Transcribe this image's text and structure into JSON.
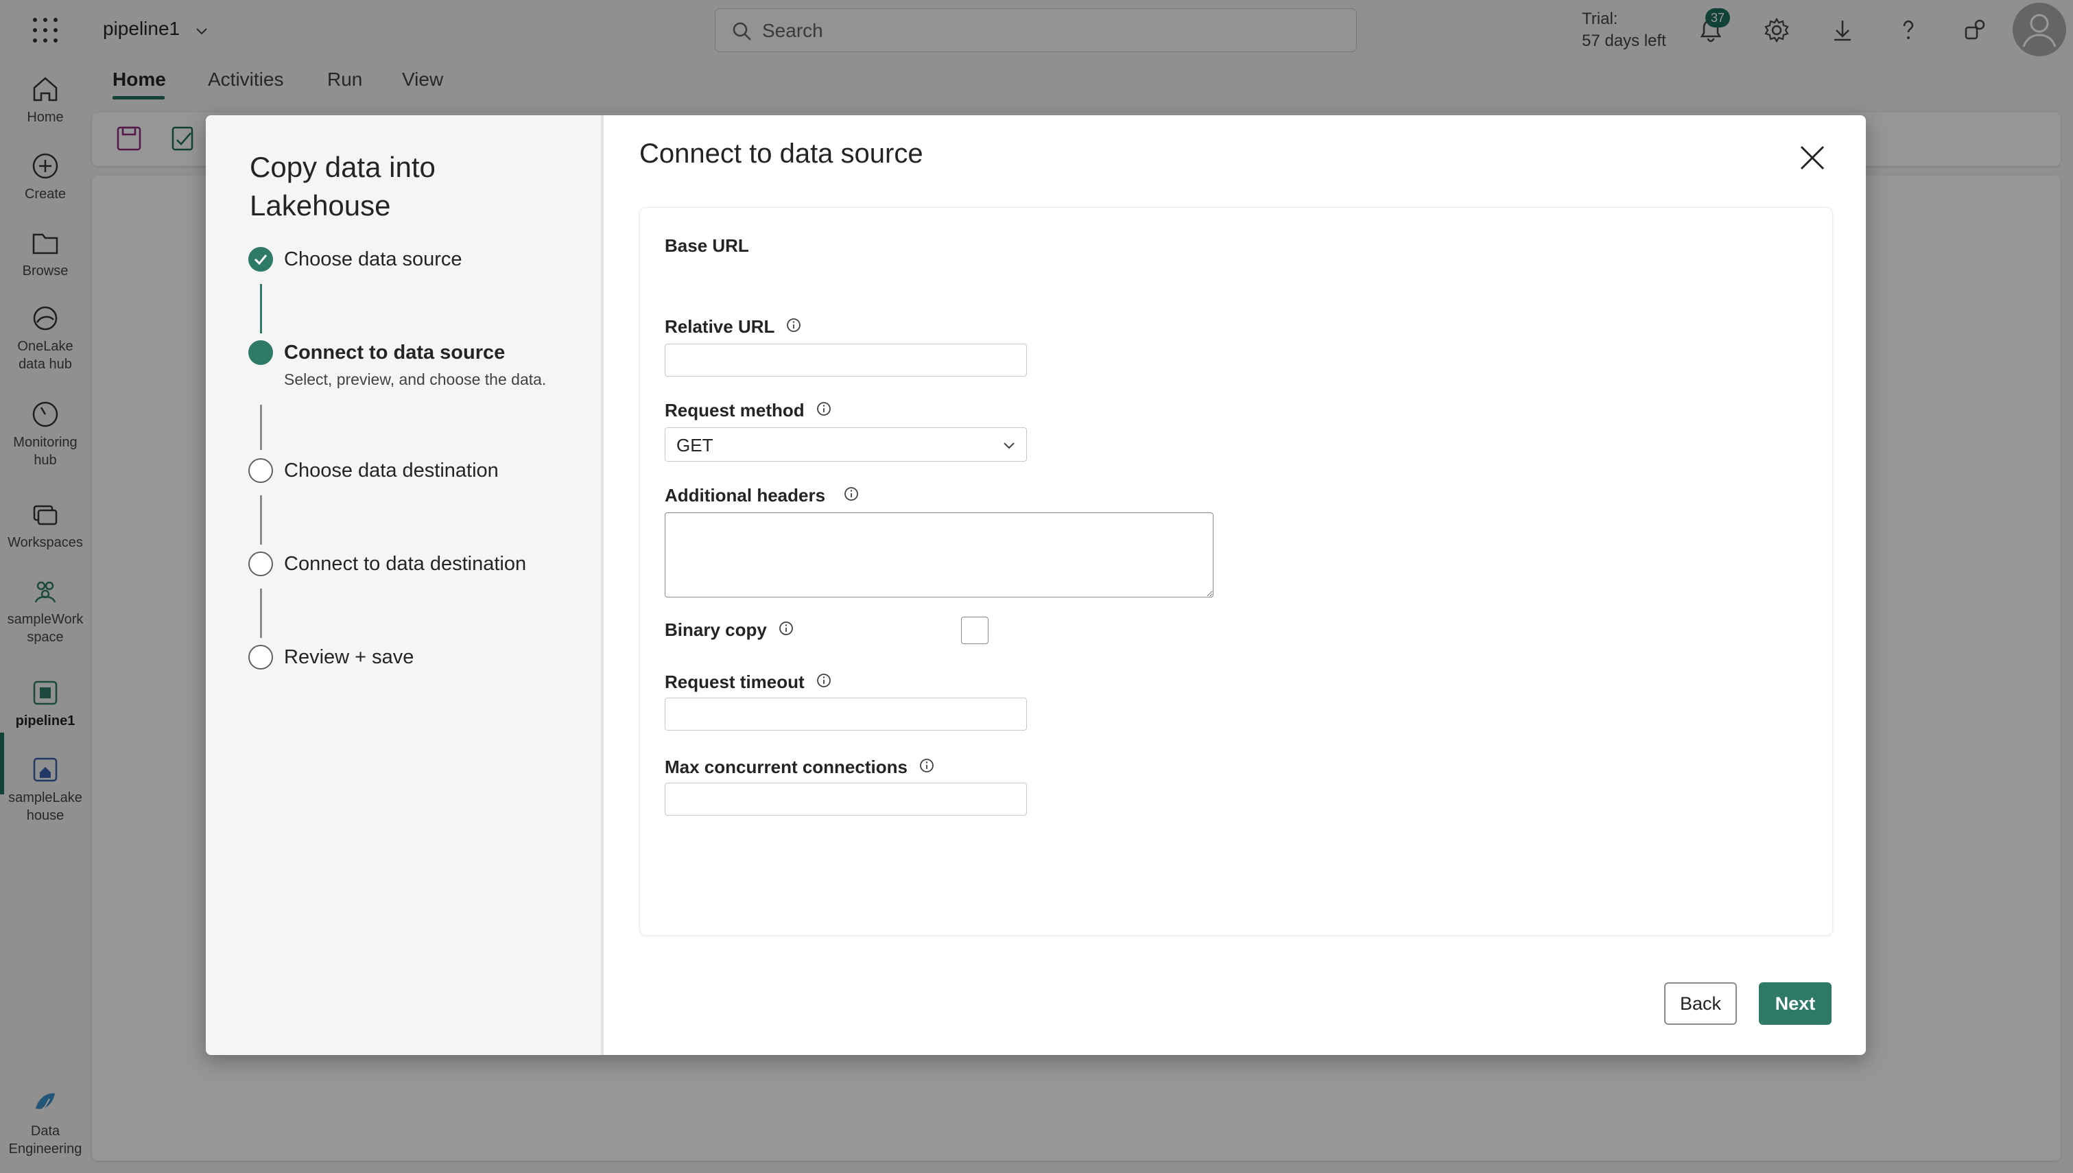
{
  "app": {
    "title": "pipeline1",
    "search_placeholder": "Search",
    "trial_line1": "Trial:",
    "trial_line2": "57 days left",
    "notification_count": "37"
  },
  "rail": [
    {
      "label": "Home",
      "icon": "home-icon"
    },
    {
      "label": "Create",
      "icon": "create-icon"
    },
    {
      "label": "Browse",
      "icon": "browse-icon"
    },
    {
      "label": "OneLake\ndata hub",
      "icon": "onelake-icon"
    },
    {
      "label": "Monitoring\nhub",
      "icon": "monitoring-icon"
    },
    {
      "label": "Workspaces",
      "icon": "workspaces-icon"
    },
    {
      "label": "sampleWork\nspace",
      "icon": "workspace-icon"
    },
    {
      "label": "pipeline1",
      "icon": "pipeline-icon"
    },
    {
      "label": "sampleLake\nhouse",
      "icon": "lakehouse-icon"
    },
    {
      "label": "Data\nEngineering",
      "icon": "data-engineering-icon"
    }
  ],
  "ribbon": {
    "tabs": [
      "Home",
      "Activities",
      "Run",
      "View"
    ],
    "active_tab": "Home"
  },
  "wizard": {
    "title": "Copy data into Lakehouse",
    "steps": [
      {
        "label": "Choose data source",
        "state": "done"
      },
      {
        "label": "Connect to data source",
        "state": "current",
        "desc": "Select, preview, and choose the data."
      },
      {
        "label": "Choose data destination",
        "state": "todo"
      },
      {
        "label": "Connect to data destination",
        "state": "todo"
      },
      {
        "label": "Review + save",
        "state": "todo"
      }
    ]
  },
  "dialog": {
    "title": "Connect to data source",
    "fields": {
      "base_url": "Base URL",
      "relative_url": "Relative URL",
      "relative_url_value": "",
      "request_method": "Request method",
      "request_method_value": "GET",
      "additional_headers": "Additional headers",
      "binary_copy": "Binary copy",
      "request_timeout": "Request timeout",
      "max_concurrent": "Max concurrent connections"
    },
    "back_label": "Back",
    "next_label": "Next"
  },
  "colors": {
    "accent": "#2f7a67",
    "badge": "#1f6f5c"
  }
}
